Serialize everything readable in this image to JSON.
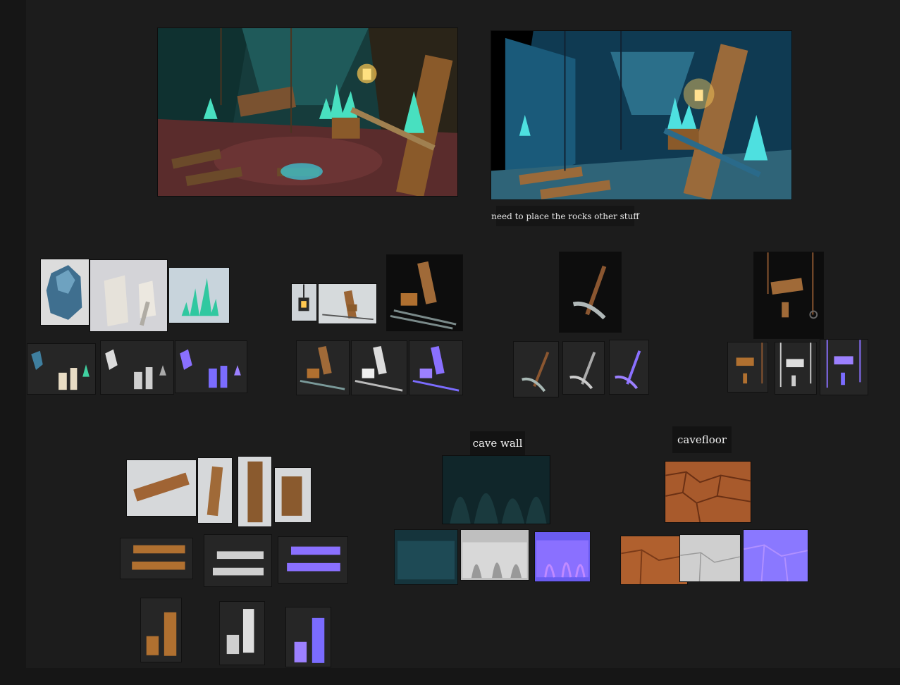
{
  "notes": {
    "main_note": "need to place the rocks other stuff",
    "cave_wall_label": "cave wall",
    "cave_floor_label": "cavefloor"
  },
  "colors": {
    "canvas": "#1c1c1c",
    "outer": "#161616",
    "crystal": "#48e0c0",
    "wood": "#9a6434",
    "lantern": "#ffc850",
    "normal_map": "#7b6cff",
    "floor_clay": "#b05a2a"
  }
}
